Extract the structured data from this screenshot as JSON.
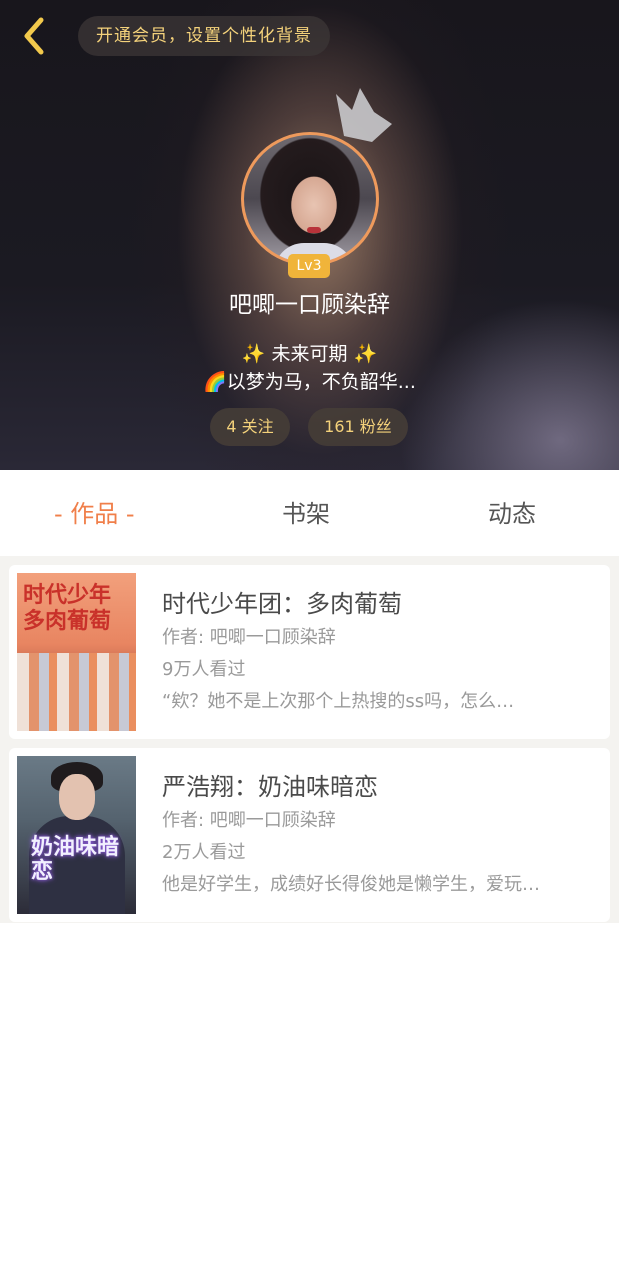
{
  "header": {
    "vip_prompt": "开通会员，设置个性化背景",
    "level": "Lv3",
    "username": "吧唧一口顾染辞",
    "bio_line1_star": "✨",
    "bio_line1_text": "未来可期",
    "bio_line2_emoji": "🌈",
    "bio_line2_text": "以梦为马，不负韶华...",
    "following": "4 关注",
    "fans": "161 粉丝"
  },
  "tabs": {
    "works": "- 作品 -",
    "shelf": "书架",
    "feed": "动态"
  },
  "works": [
    {
      "title": "时代少年团：多肉葡萄",
      "author": "作者: 吧唧一口顾染辞",
      "views": "9万人看过",
      "desc": "“欸？她不是上次那个上热搜的ss吗，怎么…",
      "cover_text": "时代少年 多肉葡萄"
    },
    {
      "title": "严浩翔：奶油味暗恋",
      "author": "作者: 吧唧一口顾染辞",
      "views": "2万人看过",
      "desc": "他是好学生，成绩好长得俊她是懒学生，爱玩…",
      "cover_text": "奶油味暗恋"
    }
  ],
  "colors": {
    "accent": "#f07f4a",
    "gold": "#f4d27b",
    "level_badge": "#f0b43a",
    "avatar_border": "#ee9a5c"
  },
  "icons": [
    "back-chevron-icon",
    "crown-icon"
  ]
}
